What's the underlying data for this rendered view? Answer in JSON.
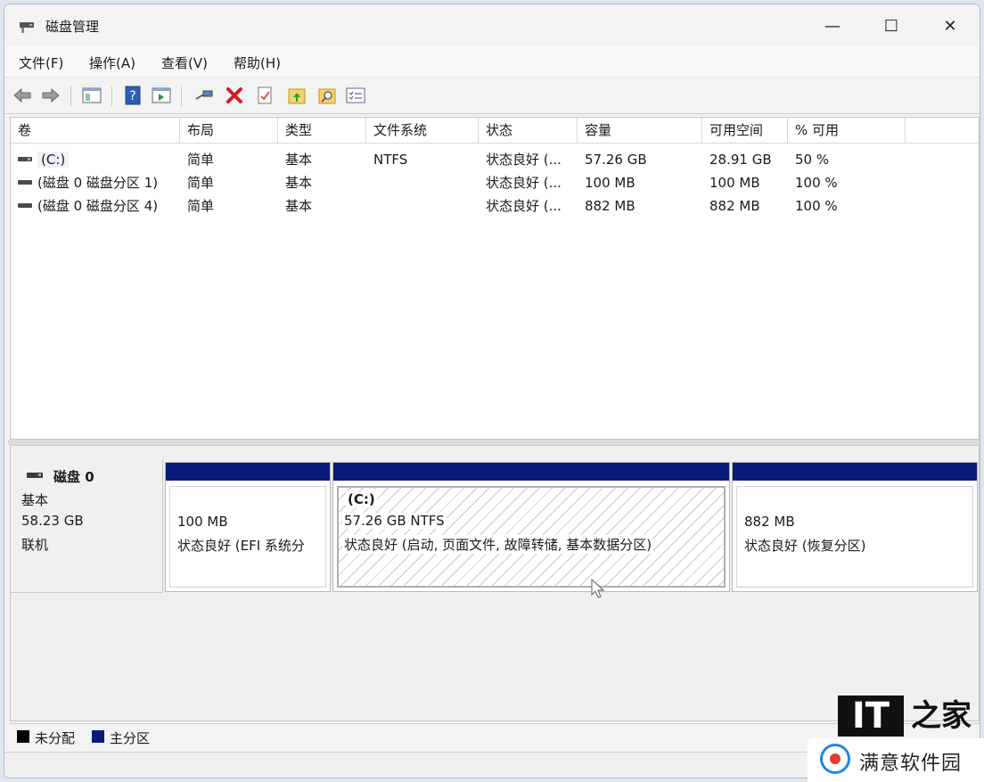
{
  "window": {
    "title": "磁盘管理",
    "minimize": "—",
    "maximize": "☐",
    "close": "✕"
  },
  "menu": [
    "文件(F)",
    "操作(A)",
    "查看(V)",
    "帮助(H)"
  ],
  "toolbar": [
    "back-arrow-icon",
    "forward-arrow-icon",
    "console-tree-icon",
    "help-icon",
    "properties-list-icon",
    "connect-disk-icon",
    "delete-icon",
    "checklist-icon",
    "folder-up-icon",
    "folder-search-icon",
    "console-list-icon"
  ],
  "volumes": {
    "columns": [
      "卷",
      "布局",
      "类型",
      "文件系统",
      "状态",
      "容量",
      "可用空间",
      "% 可用"
    ],
    "rows": [
      [
        "(C:)",
        "简单",
        "基本",
        "NTFS",
        "状态良好 (...",
        "57.26 GB",
        "28.91 GB",
        "50 %"
      ],
      [
        "(磁盘 0 磁盘分区 1)",
        "简单",
        "基本",
        "",
        "状态良好 (...",
        "100 MB",
        "100 MB",
        "100 %"
      ],
      [
        "(磁盘 0 磁盘分区 4)",
        "简单",
        "基本",
        "",
        "状态良好 (...",
        "882 MB",
        "882 MB",
        "100 %"
      ]
    ]
  },
  "disk": {
    "name": "磁盘 0",
    "type": "基本",
    "size": "58.23 GB",
    "status": "联机",
    "partitions": [
      {
        "name": "",
        "size": "100 MB",
        "status": "状态良好 (EFI 系统分"
      },
      {
        "name": "(C:)",
        "size": "57.26 GB NTFS",
        "status": "状态良好 (启动, 页面文件, 故障转储, 基本数据分区)"
      },
      {
        "name": "",
        "size": "882 MB",
        "status": "状态良好 (恢复分区)"
      }
    ]
  },
  "legend": [
    {
      "label": "未分配",
      "color": "#000000"
    },
    {
      "label": "主分区",
      "color": "#0b1b7a"
    }
  ],
  "watermark": {
    "top": "IT",
    "home": "之家",
    "bottom": "满意软件园"
  }
}
